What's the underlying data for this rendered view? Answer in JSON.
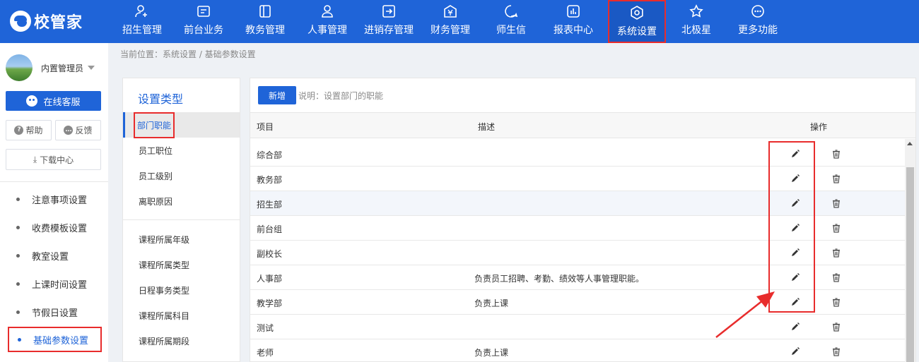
{
  "app": {
    "logo_text": "校管家",
    "brand_color": "#1f64d8",
    "highlight_color": "#e82c2c"
  },
  "nav": {
    "items": [
      {
        "label": "招生管理",
        "icon": "person-add-icon"
      },
      {
        "label": "前台业务",
        "icon": "card-icon"
      },
      {
        "label": "教务管理",
        "icon": "book-icon"
      },
      {
        "label": "人事管理",
        "icon": "person-icon"
      },
      {
        "label": "进销存管理",
        "icon": "exchange-icon"
      },
      {
        "label": "财务管理",
        "icon": "yen-icon"
      },
      {
        "label": "师生信",
        "icon": "chat-icon"
      },
      {
        "label": "报表中心",
        "icon": "bar-chart-icon"
      },
      {
        "label": "系统设置",
        "icon": "gear-icon",
        "active": true
      },
      {
        "label": "北极星",
        "icon": "star-icon"
      },
      {
        "label": "更多功能",
        "icon": "more-icon"
      }
    ]
  },
  "sidebar": {
    "user_name": "内置管理员",
    "service_label": "在线客服",
    "help_label": "帮助",
    "feedback_label": "反馈",
    "download_label": "下载中心",
    "items": [
      {
        "label": "注意事项设置"
      },
      {
        "label": "收费模板设置"
      },
      {
        "label": "教室设置"
      },
      {
        "label": "上课时间设置"
      },
      {
        "label": "节假日设置"
      },
      {
        "label": "基础参数设置",
        "active": true
      }
    ]
  },
  "breadcrumb": "当前位置：系统设置 / 基础参数设置",
  "settings_type": {
    "title": "设置类型",
    "group1": [
      "部门职能",
      "员工职位",
      "员工级别",
      "离职原因"
    ],
    "group2": [
      "课程所属年级",
      "课程所属类型",
      "日程事务类型",
      "课程所属科目",
      "课程所属期段"
    ],
    "active_index": 0
  },
  "main": {
    "new_button": "新增",
    "note": "说明：设置部门的职能",
    "columns": [
      "项目",
      "描述",
      "操作"
    ],
    "rows": [
      {
        "name": "综合部",
        "desc": ""
      },
      {
        "name": "教务部",
        "desc": ""
      },
      {
        "name": "招生部",
        "desc": ""
      },
      {
        "name": "前台组",
        "desc": ""
      },
      {
        "name": "副校长",
        "desc": ""
      },
      {
        "name": "人事部",
        "desc": "负责员工招聘、考勤、绩效等人事管理职能。"
      },
      {
        "name": "教学部",
        "desc": "负责上课"
      },
      {
        "name": "测试",
        "desc": ""
      },
      {
        "name": "老师",
        "desc": "负责上课"
      }
    ]
  }
}
